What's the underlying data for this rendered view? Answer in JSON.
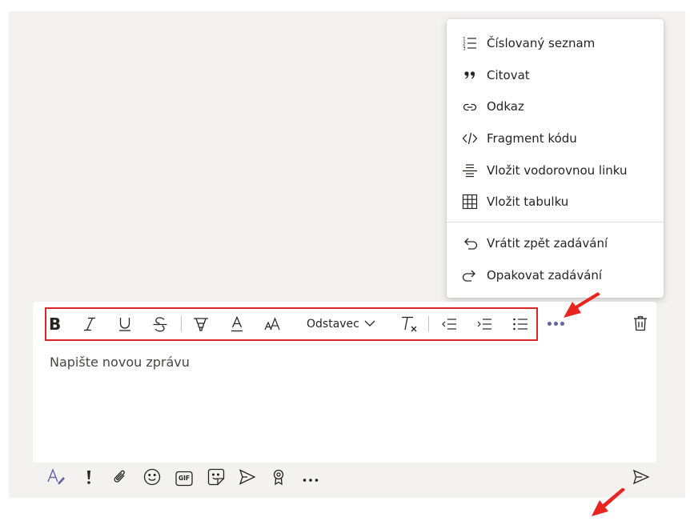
{
  "colors": {
    "accent": "#6264a7",
    "annotation": "#e8261f",
    "background": "#f3f2f1"
  },
  "format_toolbar": {
    "buttons": [
      {
        "name": "bold",
        "icon": "bold-icon"
      },
      {
        "name": "italic",
        "icon": "italic-icon"
      },
      {
        "name": "underline",
        "icon": "underline-icon"
      },
      {
        "name": "strikethrough",
        "icon": "strikethrough-icon"
      },
      {
        "name": "highlight",
        "icon": "highlighter-icon"
      },
      {
        "name": "font-color",
        "icon": "font-color-icon"
      },
      {
        "name": "font-size",
        "icon": "font-size-icon"
      },
      {
        "name": "clear-formatting",
        "icon": "clear-formatting-icon"
      },
      {
        "name": "decrease-indent",
        "icon": "outdent-icon"
      },
      {
        "name": "increase-indent",
        "icon": "indent-icon"
      },
      {
        "name": "bulleted-list",
        "icon": "bulleted-list-icon"
      }
    ],
    "paragraph_label": "Odstavec",
    "more_icon": "more-options-icon",
    "discard_icon": "trash-icon"
  },
  "compose": {
    "placeholder": "Napište novou zprávu"
  },
  "bottom_toolbar": {
    "icons": [
      "format-icon",
      "important-icon",
      "attach-icon",
      "emoji-icon",
      "gif-icon",
      "sticker-icon",
      "meet-now-icon",
      "praise-icon",
      "more-icon"
    ],
    "send_icon": "send-icon",
    "gif_text": "GIF"
  },
  "overflow_menu": {
    "items": [
      {
        "label": "Číslovaný seznam",
        "icon": "numbered-list-icon"
      },
      {
        "label": "Citovat",
        "icon": "quote-icon"
      },
      {
        "label": "Odkaz",
        "icon": "link-icon"
      },
      {
        "label": "Fragment kódu",
        "icon": "code-icon"
      },
      {
        "label": "Vložit vodorovnou linku",
        "icon": "horizontal-line-icon"
      },
      {
        "label": "Vložit tabulku",
        "icon": "table-icon"
      },
      {
        "label": "Vrátit zpět zadávání",
        "icon": "undo-icon"
      },
      {
        "label": "Opakovat zadávání",
        "icon": "redo-icon"
      }
    ]
  }
}
